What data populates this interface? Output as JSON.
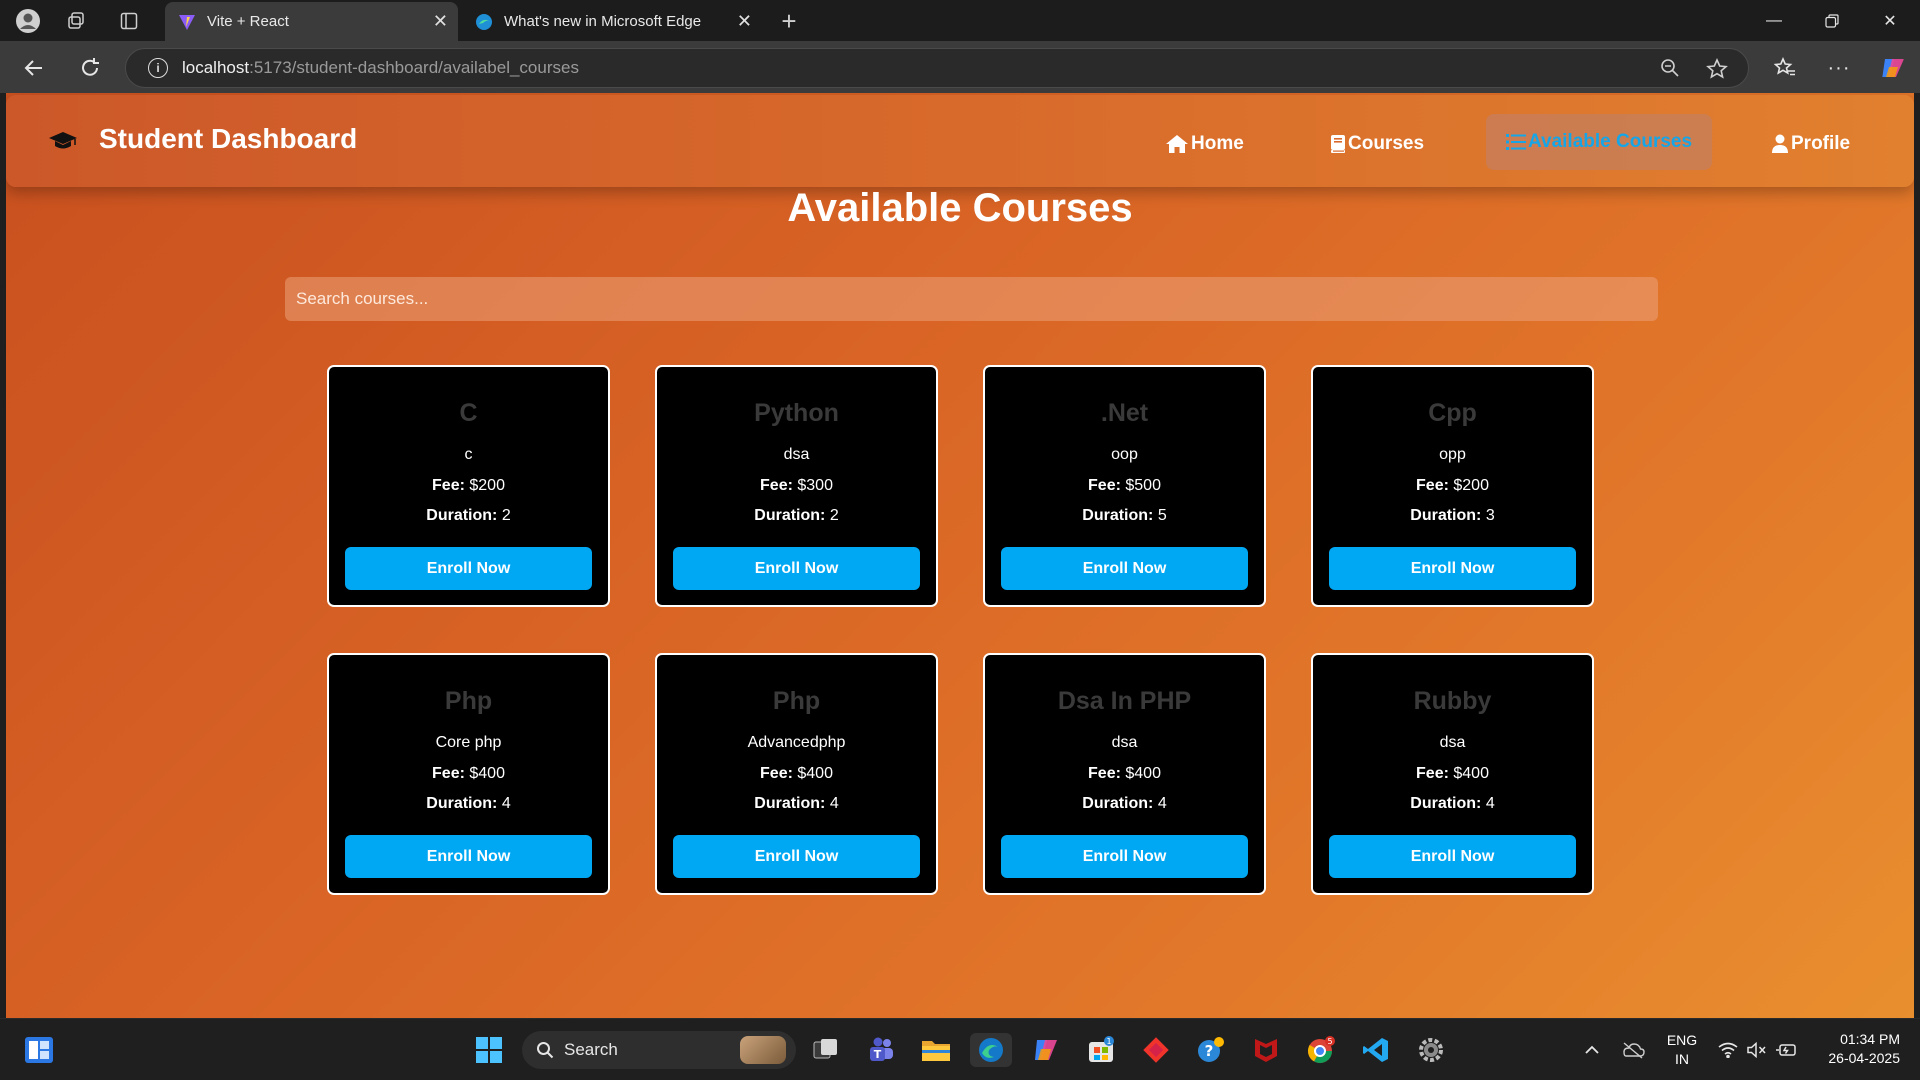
{
  "browser": {
    "tabs": [
      {
        "title": "Vite + React",
        "active": true
      },
      {
        "title": "What's new in Microsoft Edge",
        "active": false
      }
    ],
    "url_host": "localhost",
    "url_rest": ":5173/student-dashboard/availabel_courses"
  },
  "navbar": {
    "brand": "Student Dashboard",
    "items": [
      {
        "label": "Home",
        "icon": "home-icon",
        "active": false
      },
      {
        "label": "Courses",
        "icon": "book-icon",
        "active": false
      },
      {
        "label": "Available Courses",
        "icon": "list-icon",
        "active": true
      },
      {
        "label": "Profile",
        "icon": "user-icon",
        "active": false
      }
    ]
  },
  "page": {
    "title": "Available Courses",
    "search_placeholder": "Search courses...",
    "fee_label": "Fee:",
    "duration_label": "Duration:",
    "enroll_label": "Enroll Now"
  },
  "courses": [
    {
      "name": "C",
      "desc": "c",
      "fee": "$200",
      "duration": "2"
    },
    {
      "name": "Python",
      "desc": "dsa",
      "fee": "$300",
      "duration": "2"
    },
    {
      "name": ".Net",
      "desc": "oop",
      "fee": "$500",
      "duration": "5"
    },
    {
      "name": "Cpp",
      "desc": "opp",
      "fee": "$200",
      "duration": "3"
    },
    {
      "name": "Php",
      "desc": "Core php",
      "fee": "$400",
      "duration": "4"
    },
    {
      "name": "Php",
      "desc": "Advancedphp",
      "fee": "$400",
      "duration": "4"
    },
    {
      "name": "Dsa In PHP",
      "desc": "dsa",
      "fee": "$400",
      "duration": "4"
    },
    {
      "name": "Rubby",
      "desc": "dsa",
      "fee": "$400",
      "duration": "4"
    }
  ],
  "taskbar": {
    "search_label": "Search",
    "lang_line1": "ENG",
    "lang_line2": "IN",
    "time": "01:34 PM",
    "date": "26-04-2025",
    "teams_badge": "1",
    "chrome_badge": "5"
  },
  "colors": {
    "accent_blue": "#00a8f3",
    "active_nav_text": "#16a6e8",
    "page_gradient_start": "#c8501f",
    "page_gradient_end": "#e98f2f"
  }
}
